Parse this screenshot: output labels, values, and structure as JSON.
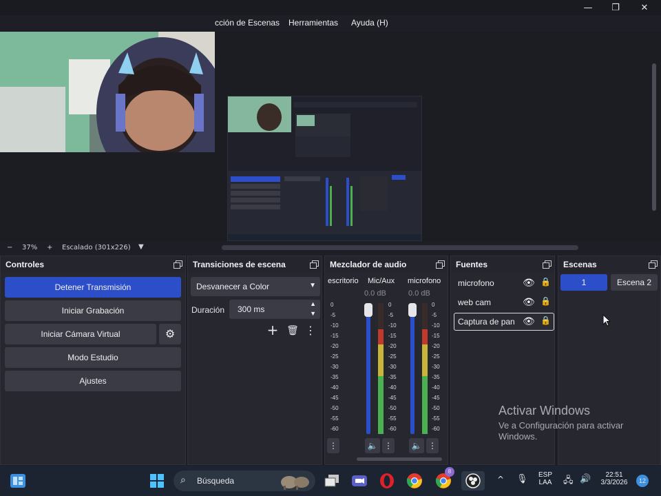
{
  "menu": {
    "items": [
      "cción de Escenas",
      "Herramientas",
      "Ayuda (H)"
    ]
  },
  "window_controls": {
    "minimize": "—",
    "maximize": "❐",
    "close": "✕"
  },
  "zoom": {
    "minus": "−",
    "percent": "37%",
    "plus": "+",
    "scale_label": "Escalado (301x226)"
  },
  "controls": {
    "title": "Controles",
    "buttons": [
      "Detener Transmisión",
      "Iniciar Grabación",
      "Iniciar Cámara Virtual",
      "Modo Estudio",
      "Ajustes"
    ]
  },
  "transitions": {
    "title": "Transiciones de escena",
    "selected": "Desvanecer a Color",
    "duration_label": "Duración",
    "duration_value": "300 ms"
  },
  "mixer": {
    "title": "Mezclador de audio",
    "channels": [
      {
        "name": "escritorio",
        "db": ""
      },
      {
        "name": "Mic/Aux",
        "db": "0.0 dB",
        "level": 0.8
      },
      {
        "name": "microfono",
        "db": "0.0 dB",
        "level": 0.8
      }
    ],
    "ticks": [
      "0",
      "-5",
      "-10",
      "-15",
      "-20",
      "-25",
      "-30",
      "-35",
      "-40",
      "-45",
      "-50",
      "-55",
      "-60"
    ]
  },
  "sources": {
    "title": "Fuentes",
    "items": [
      {
        "label": "microfono",
        "selected": false
      },
      {
        "label": "web cam",
        "selected": false
      },
      {
        "label": "Captura de pan",
        "selected": true
      }
    ]
  },
  "scenes": {
    "title": "Escenas",
    "items": [
      {
        "label": "1",
        "active": true
      },
      {
        "label": "Escena 2",
        "active": false
      }
    ]
  },
  "activation": {
    "title": "Activar Windows",
    "line1": "Ve a Configuración para activar",
    "line2": "Windows."
  },
  "taskbar": {
    "search_placeholder": "Búsqueda",
    "lang1": "ESP",
    "lang2": "LAA",
    "time": "22:51",
    "date": "3/3/2026",
    "notif_count": "12",
    "chrome_badge": "8"
  },
  "colors": {
    "accent": "#2c4fc9",
    "meter_green": "#4caf50",
    "meter_yellow": "#c8b53a",
    "meter_red": "#c0392b",
    "panel": "#26272f"
  }
}
